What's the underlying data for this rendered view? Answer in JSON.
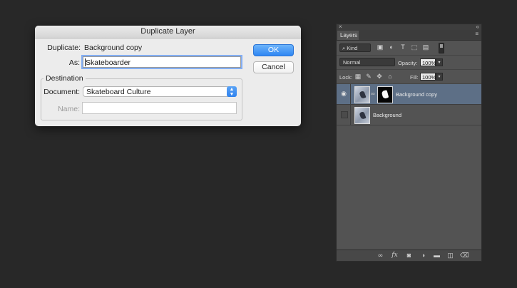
{
  "dialog": {
    "title": "Duplicate Layer",
    "duplicate_label": "Duplicate:",
    "duplicate_value": "Background copy",
    "as_label": "As:",
    "as_value": "Skateboarder",
    "ok_label": "OK",
    "cancel_label": "Cancel",
    "destination_legend": "Destination",
    "document_label": "Document:",
    "document_value": "Skateboard Culture",
    "name_label": "Name:",
    "name_value": ""
  },
  "layers_panel": {
    "close_glyph": "×",
    "collapse_glyph": "«",
    "tab_label": "Layers",
    "menu_glyph": "≡",
    "filter_kind_label": "⌕ Kind",
    "blend_mode": "Normal",
    "opacity_label": "Opacity:",
    "opacity_value": "100%",
    "lock_label": "Lock:",
    "fill_label": "Fill:",
    "fill_value": "100%",
    "layers": [
      {
        "name": "Background copy",
        "visible": true,
        "selected": true,
        "has_mask": true
      },
      {
        "name": "Background",
        "visible": false,
        "selected": false,
        "has_mask": false
      }
    ],
    "bottom_fx_label": "fx"
  }
}
